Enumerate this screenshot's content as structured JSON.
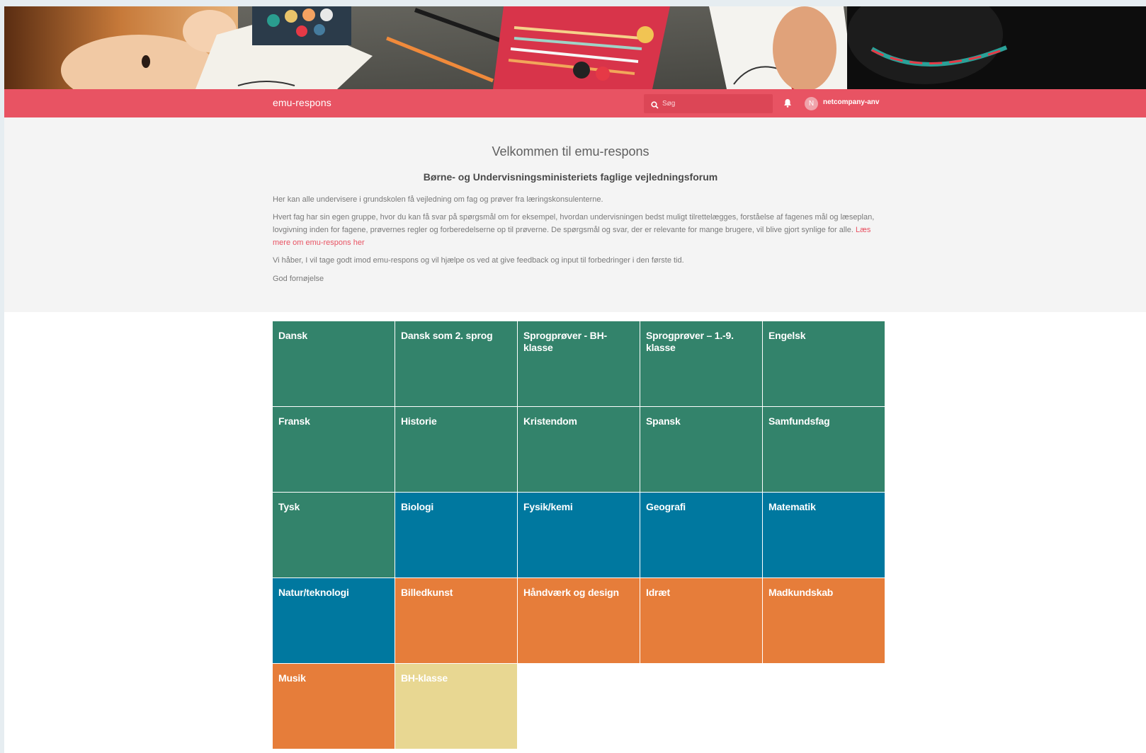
{
  "navbar": {
    "brand": "emu-respons",
    "search_placeholder": "Søg",
    "avatar_initial": "N",
    "username": "netcompany-anv"
  },
  "intro": {
    "title": "Velkommen til emu-respons",
    "subtitle": "Børne- og Undervisningsministeriets faglige vejledningsforum",
    "paragraph_1": "Her kan alle undervisere i grundskolen få vejledning om fag og prøver fra læringskonsulenterne.",
    "paragraph_2": "Hvert fag har sin egen gruppe, hvor du kan få svar på spørgsmål om for eksempel, hvordan undervisningen bedst muligt tilrettelægges, forståelse af fagenes mål og læseplan, lovgivning inden for fagene, prøvernes regler og forberedelserne op til prøverne. De spørgsmål og svar, der er relevante for mange brugere, vil blive gjort synlige for alle.",
    "read_more_link": "Læs mere om emu-respons her",
    "paragraph_3": "Vi håber, I vil tage godt imod emu-respons og vil hjælpe os ved at give feedback og input til forbedringer i den første tid.",
    "paragraph_4": "God fornøjelse"
  },
  "colors": {
    "navbar": "#e85363",
    "green": "#33836b",
    "blue": "#00789f",
    "orange": "#e67d3a",
    "yellow": "#e8d792"
  },
  "subjects": [
    {
      "label": "Dansk",
      "color": "green"
    },
    {
      "label": "Dansk som 2. sprog",
      "color": "green"
    },
    {
      "label": "Sprogprøver - BH-klasse",
      "color": "green"
    },
    {
      "label": "Sprogprøver – 1.-9. klasse",
      "color": "green"
    },
    {
      "label": "Engelsk",
      "color": "green"
    },
    {
      "label": "Fransk",
      "color": "green"
    },
    {
      "label": "Historie",
      "color": "green"
    },
    {
      "label": "Kristendom",
      "color": "green"
    },
    {
      "label": "Spansk",
      "color": "green"
    },
    {
      "label": "Samfundsfag",
      "color": "green"
    },
    {
      "label": "Tysk",
      "color": "green"
    },
    {
      "label": "Biologi",
      "color": "blue"
    },
    {
      "label": "Fysik/kemi",
      "color": "blue"
    },
    {
      "label": "Geografi",
      "color": "blue"
    },
    {
      "label": "Matematik",
      "color": "blue"
    },
    {
      "label": "Natur/teknologi",
      "color": "blue"
    },
    {
      "label": "Billedkunst",
      "color": "orange"
    },
    {
      "label": "Håndværk og design",
      "color": "orange"
    },
    {
      "label": "Idræt",
      "color": "orange"
    },
    {
      "label": "Madkundskab",
      "color": "orange"
    },
    {
      "label": "Musik",
      "color": "orange"
    },
    {
      "label": "BH-klasse",
      "color": "yellow"
    }
  ]
}
